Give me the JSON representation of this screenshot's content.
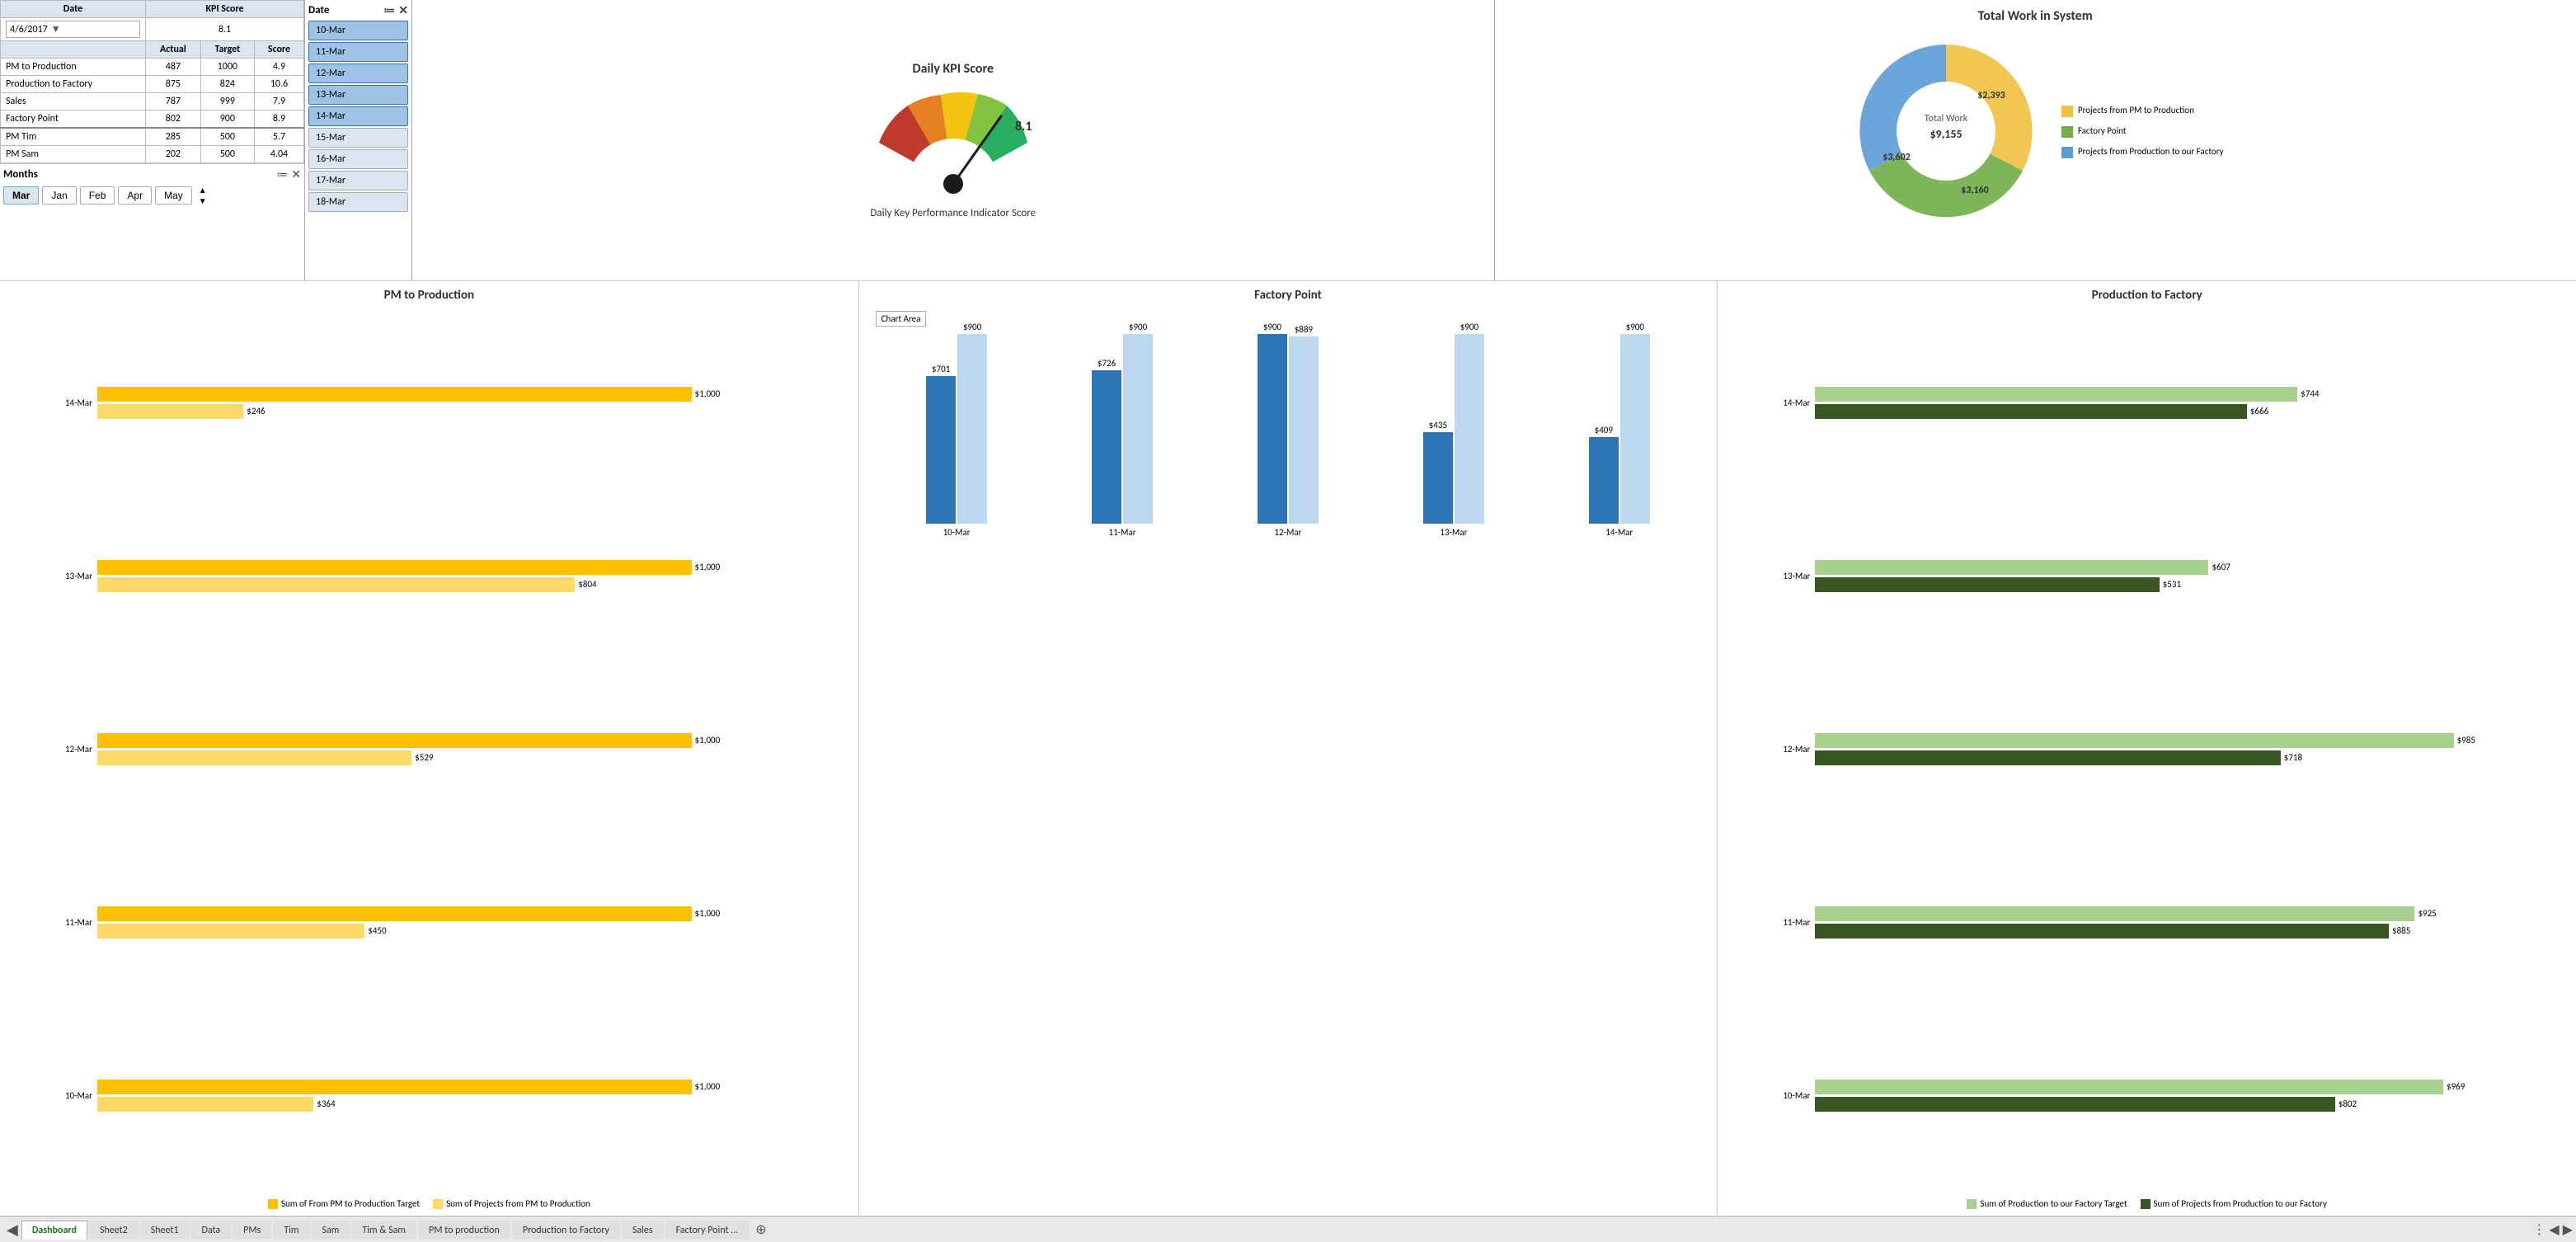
{
  "header": {
    "kpi_table": {
      "date_label": "Date",
      "kpi_score_label": "KPI Score",
      "date_value": "4/6/2017",
      "kpi_score_value": "8.1",
      "columns": [
        "",
        "Actual",
        "Target",
        "Score"
      ],
      "rows": [
        {
          "label": "PM to Production",
          "actual": 487,
          "target": 1000,
          "score": "4.9"
        },
        {
          "label": "Production to Factory",
          "actual": 875,
          "target": 824,
          "score": "10.6"
        },
        {
          "label": "Sales",
          "actual": 787,
          "target": 999,
          "score": "7.9"
        },
        {
          "label": "Factory Point",
          "actual": 802,
          "target": 900,
          "score": "8.9"
        },
        {
          "label": "PM Tim",
          "actual": 285,
          "target": 500,
          "score": "5.7"
        },
        {
          "label": "PM Sam",
          "actual": 202,
          "target": 500,
          "score": "4.04"
        }
      ]
    },
    "months": {
      "label": "Months",
      "items": [
        "Mar",
        "Jan",
        "Feb",
        "Apr",
        "May"
      ]
    },
    "date_filter": {
      "label": "Date",
      "items": [
        "10-Mar",
        "11-Mar",
        "12-Mar",
        "13-Mar",
        "14-Mar",
        "15-Mar",
        "16-Mar",
        "17-Mar",
        "18-Mar"
      ]
    },
    "daily_kpi": {
      "title": "Daily KPI Score",
      "value": "8.1",
      "subtitle": "Daily Key Performance Indicator Score"
    },
    "total_work": {
      "title": "Total Work in System",
      "center_label": "Total Work",
      "center_value": "$9,155",
      "segments": [
        {
          "label": "Projects from PM to Production",
          "value": "$2,393",
          "color": "#f0c040",
          "shape": "square"
        },
        {
          "label": "Factory Point",
          "value": "$3,602",
          "color": "#70ad47",
          "shape": "square"
        },
        {
          "label": "Projects from Production to our Factory",
          "value": "$3,160",
          "color": "#5b9bd5",
          "shape": "square"
        }
      ]
    }
  },
  "charts": {
    "pm_to_production": {
      "title": "PM to Production",
      "bars": [
        {
          "label": "14-Mar",
          "target": 1000,
          "actual": 246
        },
        {
          "label": "13-Mar",
          "target": 1000,
          "actual": 804
        },
        {
          "label": "12-Mar",
          "target": 1000,
          "actual": 529
        },
        {
          "label": "11-Mar",
          "target": 1000,
          "actual": 450
        },
        {
          "label": "10-Mar",
          "target": 1000,
          "actual": 364
        }
      ],
      "target_color": "#ffc000",
      "actual_color": "#ffd966",
      "legend": [
        {
          "label": "Sum of From PM to Production Target",
          "color": "#ffc000"
        },
        {
          "label": "Sum of Projects from PM to Production",
          "color": "#ffd966"
        }
      ]
    },
    "factory_point": {
      "title": "Factory Point",
      "bars": [
        {
          "label": "10-Mar",
          "target": 900,
          "actual": 701
        },
        {
          "label": "11-Mar",
          "target": 900,
          "actual": 726
        },
        {
          "label": "12-Mar",
          "target": 889,
          "actual": 900
        },
        {
          "label": "13-Mar",
          "target": 900,
          "actual": 435
        },
        {
          "label": "14-Mar",
          "target": 900,
          "actual": 409
        }
      ],
      "target_color": "#bdd7ee",
      "actual_color": "#2e75b6",
      "chart_area_label": "Chart Area"
    },
    "production_to_factory": {
      "title": "Production to Factory",
      "bars": [
        {
          "label": "14-Mar",
          "target": 744,
          "actual": 666
        },
        {
          "label": "13-Mar",
          "target": 607,
          "actual": 531
        },
        {
          "label": "12-Mar",
          "target": 985,
          "actual": 718
        },
        {
          "label": "11-Mar",
          "target": 925,
          "actual": 885
        },
        {
          "label": "10-Mar",
          "target": 969,
          "actual": 802
        }
      ],
      "target_color": "#a9d18e",
      "actual_color": "#375623",
      "legend": [
        {
          "label": "Sum of Production to our Factory Target",
          "color": "#a9d18e"
        },
        {
          "label": "Sum of Projects from Production to our Factory",
          "color": "#375623"
        }
      ]
    }
  },
  "tabs": {
    "items": [
      "Dashboard",
      "Sheet2",
      "Sheet1",
      "Data",
      "PMs",
      "Tim",
      "Sam",
      "Tim & Sam",
      "PM to production",
      "Production to Factory",
      "Sales",
      "Factory Point ..."
    ],
    "active": "Dashboard"
  }
}
